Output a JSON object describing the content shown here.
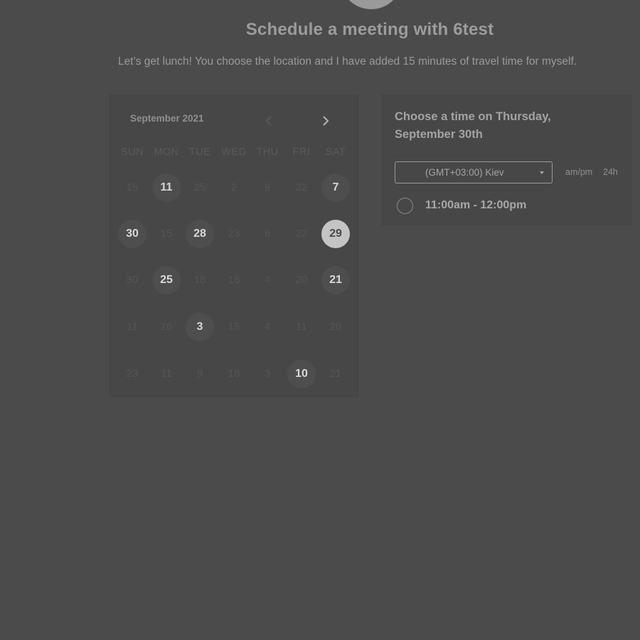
{
  "header": {
    "title": "Schedule a meeting with 6test",
    "subtitle": "Let’s get lunch! You choose the location and I have added 15 minutes of travel time for myself."
  },
  "calendar": {
    "month_label": "September 2021",
    "prev_icon": "chevron-left-icon",
    "next_icon": "chevron-right-icon",
    "weekdays": [
      "SUN",
      "MON",
      "TUE",
      "WED",
      "THU",
      "FRI",
      "SAT"
    ],
    "weeks": [
      [
        {
          "label": "15",
          "state": "off"
        },
        {
          "label": "11",
          "state": "available"
        },
        {
          "label": "25",
          "state": "off"
        },
        {
          "label": "2",
          "state": "off"
        },
        {
          "label": "9",
          "state": "off"
        },
        {
          "label": "22",
          "state": "off"
        },
        {
          "label": "7",
          "state": "available"
        }
      ],
      [
        {
          "label": "30",
          "state": "available"
        },
        {
          "label": "15",
          "state": "off"
        },
        {
          "label": "28",
          "state": "available"
        },
        {
          "label": "23",
          "state": "off"
        },
        {
          "label": "6",
          "state": "off"
        },
        {
          "label": "22",
          "state": "off"
        },
        {
          "label": "29",
          "state": "selected"
        }
      ],
      [
        {
          "label": "30",
          "state": "off"
        },
        {
          "label": "25",
          "state": "available"
        },
        {
          "label": "18",
          "state": "off"
        },
        {
          "label": "16",
          "state": "off"
        },
        {
          "label": "4",
          "state": "off"
        },
        {
          "label": "20",
          "state": "off"
        },
        {
          "label": "21",
          "state": "available"
        }
      ],
      [
        {
          "label": "11",
          "state": "off"
        },
        {
          "label": "26",
          "state": "off"
        },
        {
          "label": "3",
          "state": "available"
        },
        {
          "label": "15",
          "state": "off"
        },
        {
          "label": "4",
          "state": "off"
        },
        {
          "label": "11",
          "state": "off"
        },
        {
          "label": "20",
          "state": "off"
        }
      ],
      [
        {
          "label": "23",
          "state": "off"
        },
        {
          "label": "11",
          "state": "off"
        },
        {
          "label": "9",
          "state": "off"
        },
        {
          "label": "18",
          "state": "off"
        },
        {
          "label": "3",
          "state": "off"
        },
        {
          "label": "10",
          "state": "available"
        },
        {
          "label": "21",
          "state": "off"
        }
      ]
    ]
  },
  "time_panel": {
    "heading": "Choose a time on Thursday, September 30th",
    "timezone": "(GMT+03:00) Kiev",
    "format_ampm": "am/pm",
    "format_24": "24h",
    "slots": [
      {
        "label": "11:00am - 12:00pm"
      }
    ]
  },
  "colors": {
    "background": "#4b4b4b",
    "selected_day": "#c4c4c4",
    "available_day": "#4e4e4e"
  }
}
